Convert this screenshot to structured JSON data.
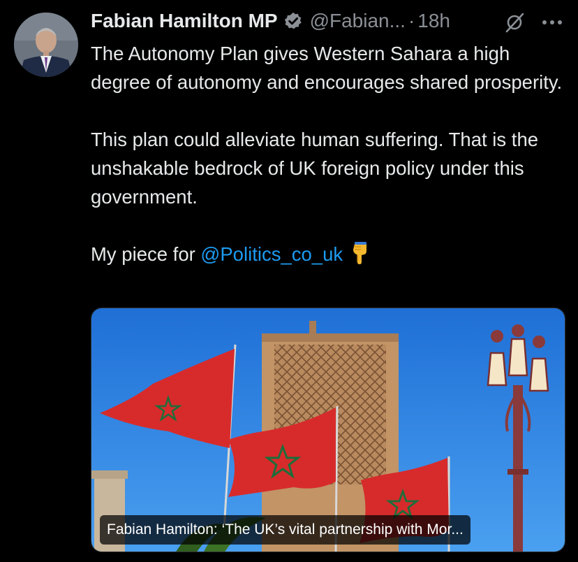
{
  "author": {
    "display_name": "Fabian Hamilton MP",
    "handle": "@Fabian...",
    "separator": "·",
    "time": "18h",
    "verified_icon": "verified-badge-icon",
    "verified_color": "#1d9bf0"
  },
  "tweet": {
    "paragraph_1": "The Autonomy Plan gives Western Sahara a high degree of autonomy and encourages shared prosperity.",
    "paragraph_2": "This plan could alleviate human suffering. That is the unshakable bedrock of UK foreign policy under this government.",
    "paragraph_3_prefix": "My piece for ",
    "mention": "@Politics_co_uk",
    "emoji": "pointing-down-hand-icon"
  },
  "card": {
    "caption": "Fabian Hamilton: ‘The UK’s vital partnership with Mor..."
  },
  "colors": {
    "background": "#000000",
    "text": "#e7e9ea",
    "muted": "#8b9096",
    "link": "#1d9bf0"
  }
}
